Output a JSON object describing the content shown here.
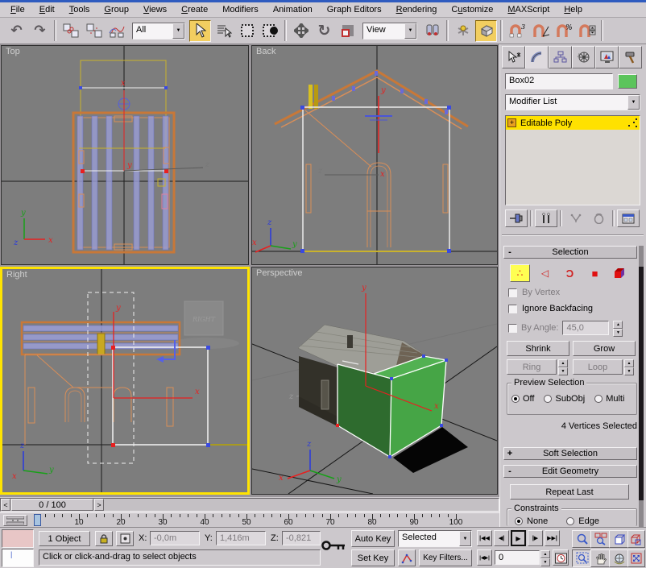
{
  "menu": {
    "items": [
      {
        "label": "File",
        "u": 0
      },
      {
        "label": "Edit",
        "u": 0
      },
      {
        "label": "Tools",
        "u": 0
      },
      {
        "label": "Group",
        "u": 0
      },
      {
        "label": "Views",
        "u": 0
      },
      {
        "label": "Create",
        "u": 0
      },
      {
        "label": "Modifiers",
        "u": -1
      },
      {
        "label": "Animation",
        "u": -1
      },
      {
        "label": "Graph Editors",
        "u": -1
      },
      {
        "label": "Rendering",
        "u": 0
      },
      {
        "label": "Customize",
        "u": 1
      },
      {
        "label": "MAXScript",
        "u": 0
      },
      {
        "label": "Help",
        "u": 0
      }
    ]
  },
  "toolbar": {
    "selection_filter": "All",
    "coord_system": "View",
    "snap_badge": "3",
    "percent_badge": "%"
  },
  "viewports": {
    "top": "Top",
    "back": "Back",
    "right": "Right",
    "perspective": "Perspective",
    "right_watermark": "RIGHT"
  },
  "command_panel": {
    "object_name": "Box02",
    "modifier_list": "Modifier List",
    "stack_item": "Editable Poly",
    "selection": {
      "title": "Selection",
      "by_vertex": "By Vertex",
      "ignore_backfacing": "Ignore Backfacing",
      "by_angle": "By Angle:",
      "angle_value": "45,0",
      "shrink": "Shrink",
      "grow": "Grow",
      "ring": "Ring",
      "loop": "Loop",
      "preview_title": "Preview Selection",
      "off": "Off",
      "subobj": "SubObj",
      "multi": "Multi",
      "status": "4 Vertices Selected"
    },
    "soft_selection": "Soft Selection",
    "edit_geometry": "Edit Geometry",
    "repeat_last": "Repeat Last",
    "constraints": {
      "title": "Constraints",
      "none": "None",
      "edge": "Edge"
    }
  },
  "timeline": {
    "slider_label": "0 / 100",
    "prev_glyph": "<",
    "next_glyph": ">",
    "tick_labels": [
      "0",
      "10",
      "20",
      "30",
      "40",
      "50",
      "60",
      "70",
      "80",
      "90",
      "100"
    ]
  },
  "status": {
    "object_count": "1 Object",
    "x_label": "X:",
    "x_value": "-0,0m",
    "y_label": "Y:",
    "y_value": "1,416m",
    "z_label": "Z:",
    "z_value": "-0,821",
    "prompt": "Click or click-and-drag to select objects",
    "auto_key": "Auto Key",
    "set_key": "Set Key",
    "selected": "Selected",
    "key_filters": "Key Filters...",
    "frame": "0"
  },
  "glyphs": {
    "dropdown": "▼",
    "minus": "-",
    "plus": "+",
    "up": "▲",
    "down": "▼",
    "undo": "↶",
    "redo": "↷",
    "rotate": "↻",
    "go_start": "|◀◀",
    "prev_frame": "◀|",
    "play": "▶",
    "next_frame": "|▶",
    "go_end": "▶▶|",
    "key_step": "|◀▶|",
    "vertex": "∴",
    "edge": "◁",
    "border": "Ɔ",
    "polygon": "■"
  },
  "colors": {
    "accent_yellow": "#f2ce60",
    "active_viewport_border": "#ffe400",
    "stack_highlight": "#ffe100",
    "object_color": "#5cc45c",
    "viewport_background": "#7d7d7d"
  }
}
